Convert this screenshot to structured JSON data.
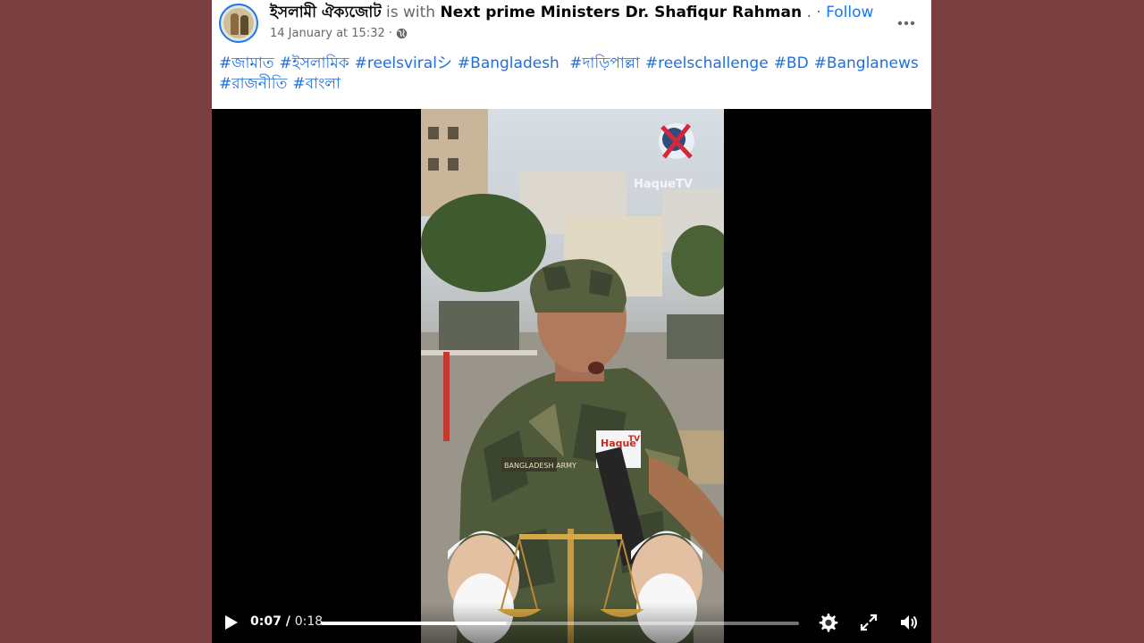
{
  "post": {
    "author": "ইসলামী ঐক্যজোট",
    "with_text": "is with",
    "tagged": "Next prime Ministers Dr. Shafiqur Rahman",
    "separator": ". ·",
    "follow_label": "Follow",
    "timestamp": "14 January at 15:32",
    "timestamp_sep": "·",
    "privacy_icon": "globe-icon",
    "more_icon": "more-horizontal-icon",
    "hashtags": [
      "#জামাত",
      "#ইসলামিক",
      "#reelsviralシ",
      "#Bangladesh",
      "#দাড়িপাল্লা",
      "#reelschallenge",
      "#BD",
      "#Banglanews",
      "#রাজনীতি",
      "#বাংলা"
    ]
  },
  "video": {
    "current_time": "0:07",
    "time_separator": "/",
    "duration": "0:18",
    "progress": 0.389,
    "play_icon": "play-icon",
    "settings_icon": "gear-icon",
    "fullscreen_icon": "fullscreen-icon",
    "volume_icon": "volume-icon"
  },
  "colors": {
    "page_background": "#7a4040",
    "link_blue": "#1877f2",
    "hashtag_blue": "#216fdb",
    "muted_text": "#65676b"
  }
}
